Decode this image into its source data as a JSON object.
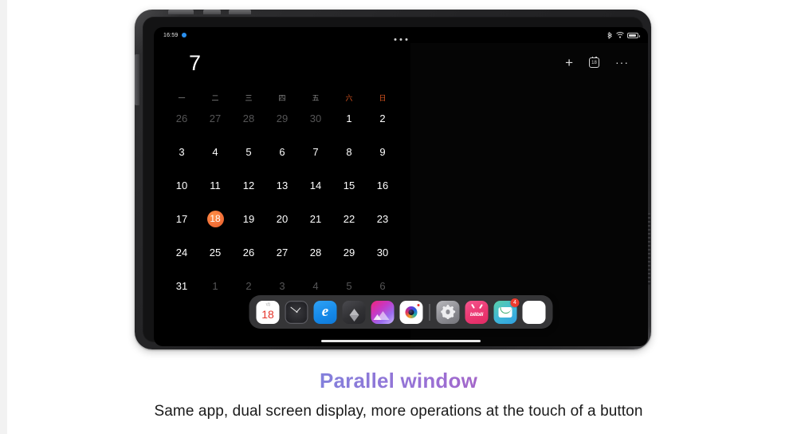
{
  "page": {
    "background_color": "#ffffff",
    "left_strip_color": "#f2f2f2"
  },
  "caption": {
    "title": "Parallel window",
    "subtitle": "Same app, dual screen display, more operations at the touch of a button",
    "gradient_from": "#5b9ee0",
    "gradient_to": "#d23b86",
    "subtitle_color": "#1a1a1a"
  },
  "device": {
    "type": "tablet",
    "frame_color": "#242426",
    "screen_background": "#000000",
    "buttons": {
      "volume_up": "volume-up-button",
      "volume_down": "volume-down-button",
      "power": "power-button",
      "side": "side-button"
    },
    "camera_label": "front-camera",
    "speaker_label": "speaker-grille"
  },
  "status_bar": {
    "time": "16:59",
    "recording_dot_color": "#2a90f0",
    "icons": [
      "bluetooth-icon",
      "wifi-icon",
      "battery-icon"
    ],
    "battery_level_pct": 65
  },
  "window_handle": {
    "label": "multi-window-handle",
    "dots": 3
  },
  "calendar": {
    "month_title": "7",
    "accent_color": "#f4723a",
    "weekend_color": "#d9541f",
    "muted_color": "#555556",
    "weekdays": [
      {
        "label": "一",
        "weekend": false
      },
      {
        "label": "二",
        "weekend": false
      },
      {
        "label": "三",
        "weekend": false
      },
      {
        "label": "四",
        "weekend": false
      },
      {
        "label": "五",
        "weekend": false
      },
      {
        "label": "六",
        "weekend": true
      },
      {
        "label": "日",
        "weekend": true
      }
    ],
    "today": 18,
    "weeks": [
      [
        {
          "d": "26",
          "muted": true
        },
        {
          "d": "27",
          "muted": true
        },
        {
          "d": "28",
          "muted": true
        },
        {
          "d": "29",
          "muted": true
        },
        {
          "d": "30",
          "muted": true
        },
        {
          "d": "1",
          "muted": false
        },
        {
          "d": "2",
          "muted": false
        }
      ],
      [
        {
          "d": "3",
          "muted": false
        },
        {
          "d": "4",
          "muted": false
        },
        {
          "d": "5",
          "muted": false
        },
        {
          "d": "6",
          "muted": false
        },
        {
          "d": "7",
          "muted": false
        },
        {
          "d": "8",
          "muted": false
        },
        {
          "d": "9",
          "muted": false
        }
      ],
      [
        {
          "d": "10",
          "muted": false
        },
        {
          "d": "11",
          "muted": false
        },
        {
          "d": "12",
          "muted": false
        },
        {
          "d": "13",
          "muted": false
        },
        {
          "d": "14",
          "muted": false
        },
        {
          "d": "15",
          "muted": false
        },
        {
          "d": "16",
          "muted": false
        }
      ],
      [
        {
          "d": "17",
          "muted": false
        },
        {
          "d": "18",
          "muted": false,
          "today": true
        },
        {
          "d": "19",
          "muted": false
        },
        {
          "d": "20",
          "muted": false
        },
        {
          "d": "21",
          "muted": false
        },
        {
          "d": "22",
          "muted": false
        },
        {
          "d": "23",
          "muted": false
        }
      ],
      [
        {
          "d": "24",
          "muted": false
        },
        {
          "d": "25",
          "muted": false
        },
        {
          "d": "26",
          "muted": false
        },
        {
          "d": "27",
          "muted": false
        },
        {
          "d": "28",
          "muted": false
        },
        {
          "d": "29",
          "muted": false
        },
        {
          "d": "30",
          "muted": false
        }
      ],
      [
        {
          "d": "31",
          "muted": false
        },
        {
          "d": "1",
          "muted": true
        },
        {
          "d": "2",
          "muted": true
        },
        {
          "d": "3",
          "muted": true
        },
        {
          "d": "4",
          "muted": true
        },
        {
          "d": "5",
          "muted": true
        },
        {
          "d": "6",
          "muted": true
        }
      ]
    ]
  },
  "toolbar": {
    "add_label": "+",
    "today_label": "18",
    "more_label": "···",
    "items": [
      "add-event-icon",
      "jump-to-today-icon",
      "more-options-icon"
    ]
  },
  "right_pane": {
    "content": "",
    "note": "empty second window pane"
  },
  "dock": {
    "background": "rgba(58,58,60,0.92)",
    "apps": [
      {
        "name": "calendar",
        "label": "18",
        "sublabel": "7月"
      },
      {
        "name": "clock",
        "label": ""
      },
      {
        "name": "browser",
        "label": "e"
      },
      {
        "name": "creator",
        "label": ""
      },
      {
        "name": "gallery",
        "label": ""
      },
      {
        "name": "camera",
        "label": ""
      },
      {
        "name": "settings",
        "label": ""
      },
      {
        "name": "bilibili",
        "label": "bilibili"
      },
      {
        "name": "mail",
        "label": "",
        "badge": "4"
      },
      {
        "name": "app-drawer",
        "label": ""
      }
    ]
  },
  "home_indicator": {
    "label": "home-indicator-bar",
    "color": "#e8e8e8"
  }
}
